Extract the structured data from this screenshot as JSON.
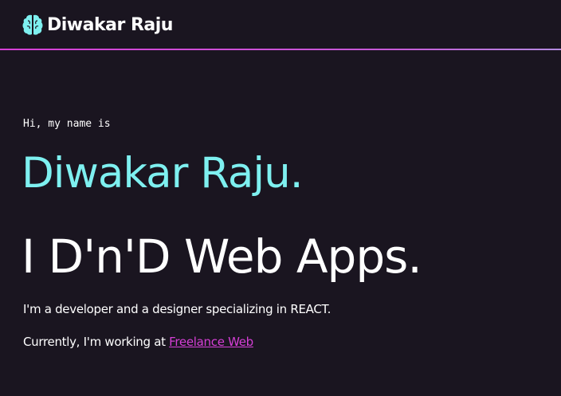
{
  "header": {
    "brand_name": "Diwakar Raju",
    "brand_icon": "brain-icon",
    "accent_line_color": "#d63fd6"
  },
  "hero": {
    "greeting": "Hi, my name is",
    "name": "Diwakar Raju.",
    "tagline": "I D'n'D Web Apps.",
    "description": "I'm a developer and a designer specializing in REACT.",
    "current_prefix": "Currently, I'm working at ",
    "current_link": "Freelance Web"
  },
  "colors": {
    "background": "#1a1520",
    "name_color": "#7ef0f0",
    "link_color": "#d63fd6",
    "text_color": "#ffffff"
  }
}
